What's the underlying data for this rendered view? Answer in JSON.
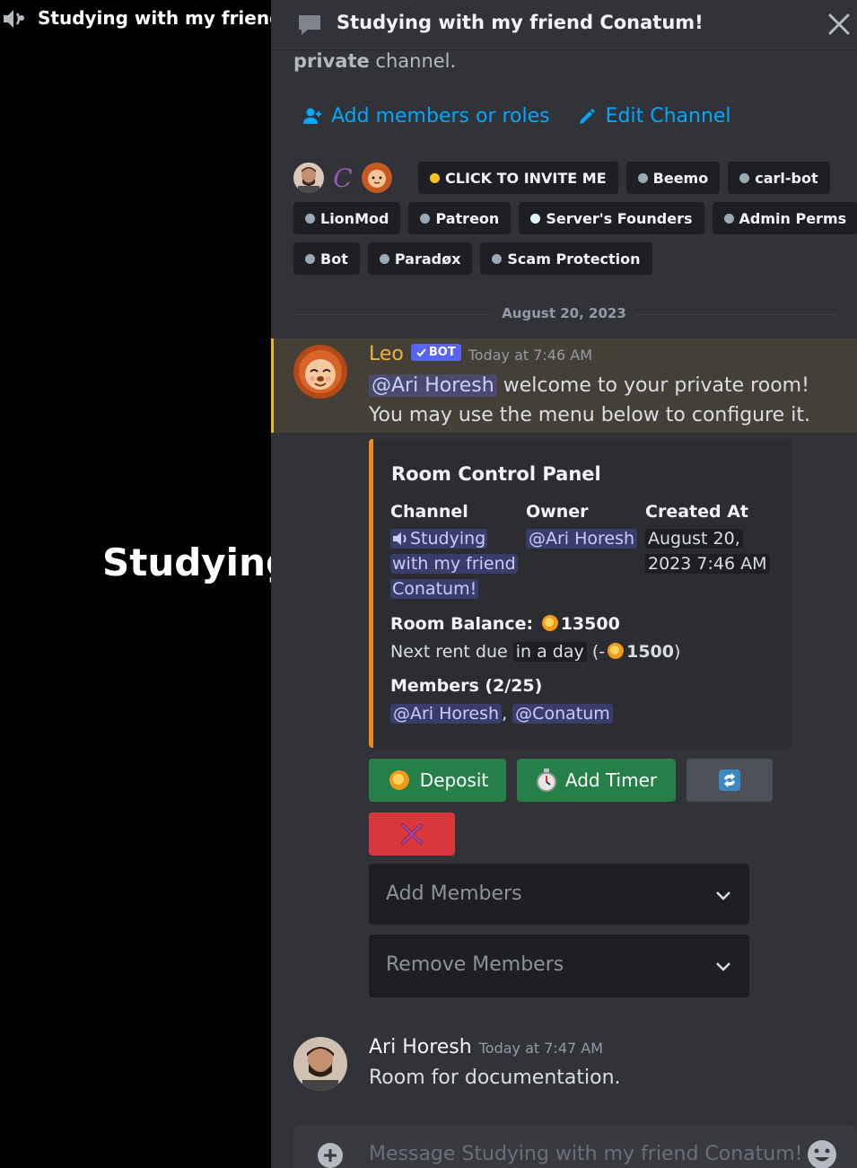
{
  "background_window": {
    "voice_channel_title": "Studying with my friend C",
    "stage_title": "Studying"
  },
  "thread": {
    "title": "Studying with my friend Conatum!",
    "intro_bold": "private",
    "intro_rest": " channel.",
    "actions": {
      "add_members": "Add members or roles",
      "edit_channel": "Edit Channel"
    },
    "roles_row1": [
      "CLICK TO INVITE ME",
      "Beemo",
      "carl-bot"
    ],
    "roles_row2": [
      "LionMod",
      "Patreon",
      "Server's Founders",
      "Admin Perms"
    ],
    "roles_row3": [
      "Bot",
      "Paradøx",
      "Scam Protection"
    ],
    "role_colors": {
      "click_to_invite": "#f5c518",
      "default": "#99aab5",
      "servers_founders": "#dff3ff"
    },
    "date_divider": "August 20, 2023"
  },
  "messages": {
    "leo": {
      "author": "Leo",
      "author_color": "#f0b232",
      "bot_tag": "BOT",
      "timestamp": "Today at 7:46 AM",
      "mention": "@Ari Horesh",
      "line1_rest": " welcome to your private room!",
      "line2": "You may use the menu below to configure it."
    },
    "embed": {
      "title": "Room Control Panel",
      "channel_label": "Channel",
      "channel_value_line1": "Studying",
      "channel_value_line2": "with my friend",
      "channel_value_line3": "Conatum!",
      "owner_label": "Owner",
      "owner_value": "@Ari Horesh",
      "created_label": "Created At",
      "created_value_line1": "August 20,",
      "created_value_line2": "2023 7:46 AM",
      "balance_label": "Room Balance:",
      "balance_value": "13500",
      "rent_prefix": "Next rent due",
      "rent_when": "in a day",
      "rent_open": "(-",
      "rent_amount": "1500",
      "rent_close": ")",
      "members_label": "Members (2/25)",
      "member1": "@Ari Horesh",
      "member_sep": ",",
      "member2": "@Conatum"
    },
    "buttons": {
      "deposit": "Deposit",
      "add_timer": "Add Timer"
    },
    "selects": {
      "add_members": "Add Members",
      "remove_members": "Remove Members"
    },
    "ari": {
      "author": "Ari Horesh",
      "timestamp": "Today at 7:47 AM",
      "content": "Room for documentation."
    }
  },
  "composer": {
    "placeholder": "Message Studying with my friend Conatum!"
  }
}
